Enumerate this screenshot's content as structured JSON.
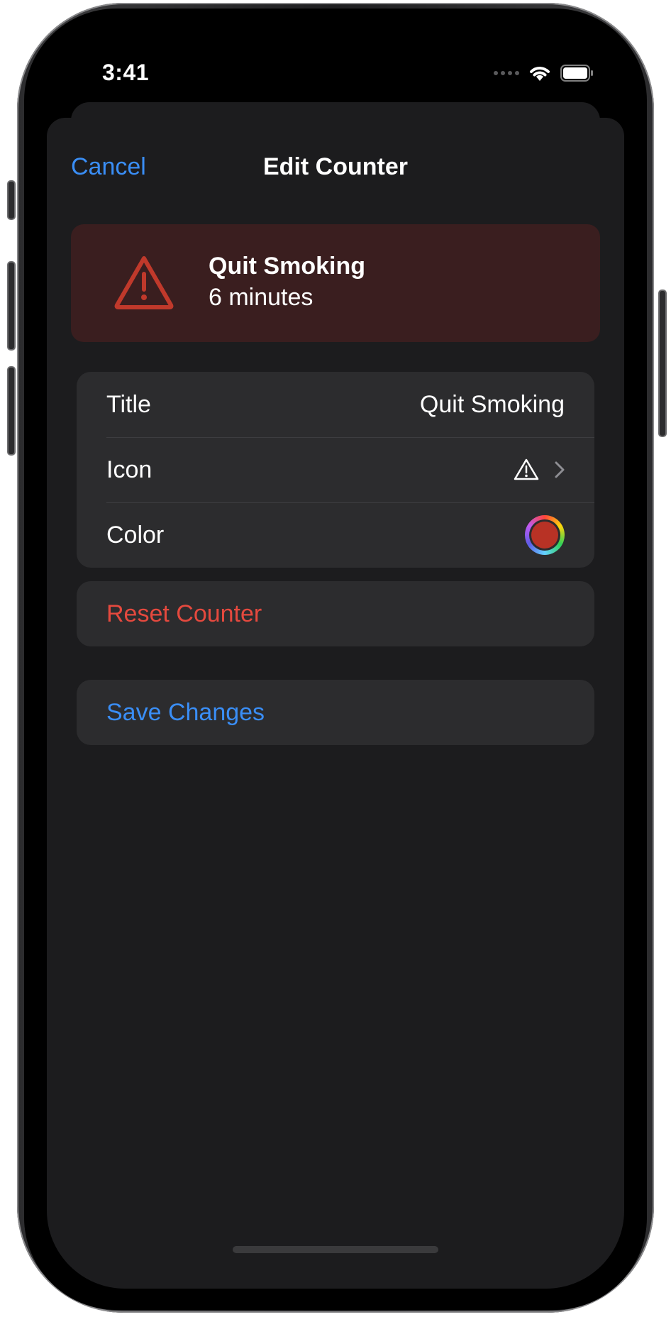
{
  "status_bar": {
    "time": "3:41"
  },
  "nav": {
    "cancel_label": "Cancel",
    "title": "Edit Counter"
  },
  "preview": {
    "icon": "warning-triangle-icon",
    "title": "Quit Smoking",
    "subtitle": "6 minutes",
    "accent_color": "#c0392b",
    "background_color": "#3a1e1f"
  },
  "settings": {
    "title_label": "Title",
    "title_value": "Quit Smoking",
    "icon_label": "Icon",
    "icon_value": "warning-triangle-icon",
    "color_label": "Color",
    "color_value": "#b83225"
  },
  "actions": {
    "reset_label": "Reset Counter",
    "reset_color": "#e5493e",
    "save_label": "Save Changes",
    "save_color": "#3a8ef6"
  }
}
